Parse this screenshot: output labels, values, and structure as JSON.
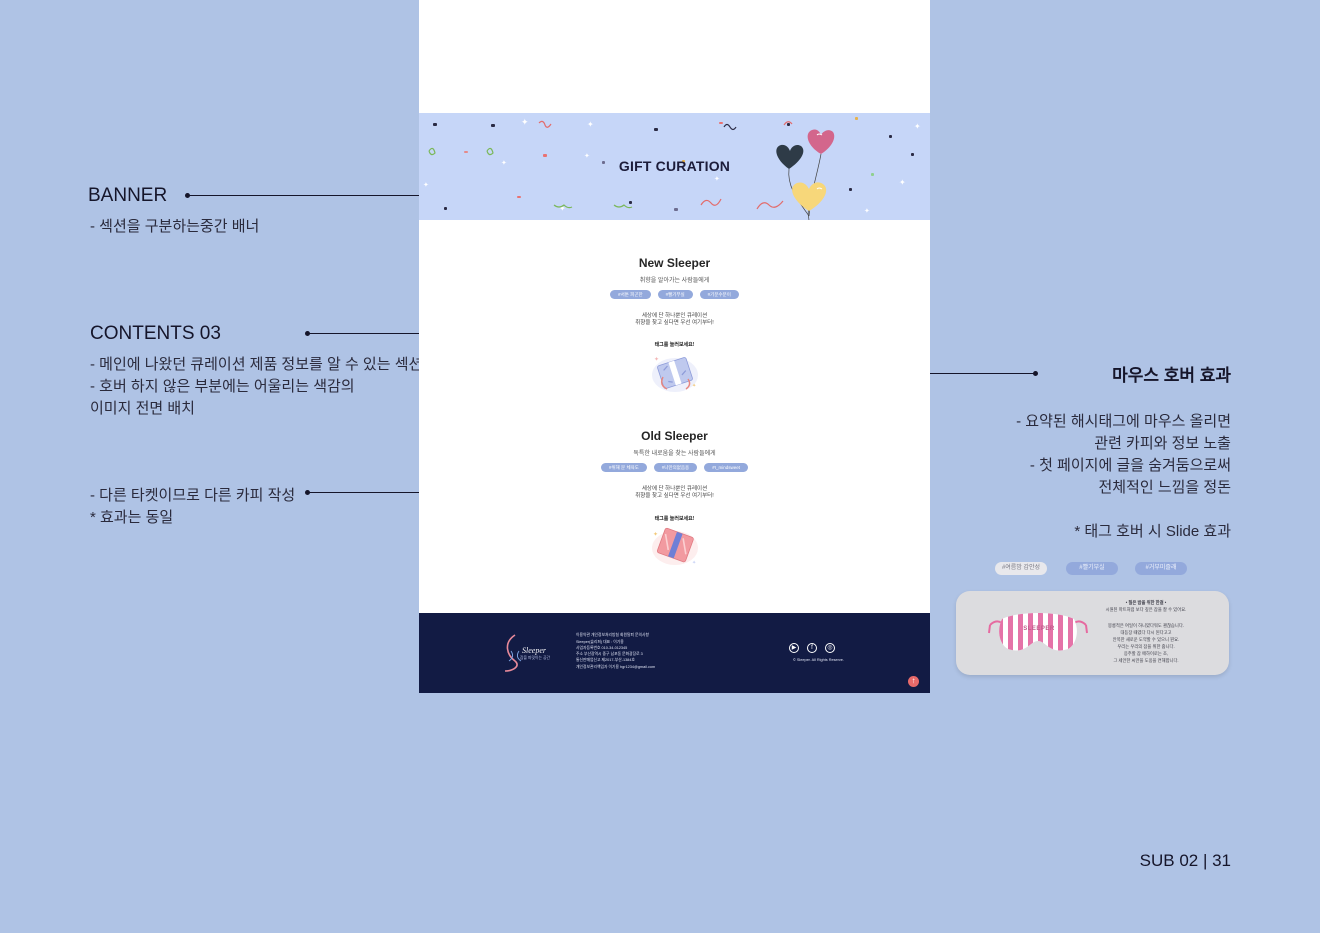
{
  "annotations": {
    "banner": {
      "title": "BANNER",
      "lines": [
        "- 섹션을 구분하는중간 배너"
      ]
    },
    "contents": {
      "title": "CONTENTS 03",
      "lines": [
        "- 메인에 나왔던 큐레이션 제품 정보를 알 수 있는 섹션",
        "- 호버 하지 않은 부분에는 어울리는 색감의",
        "이미지 전면 배치"
      ]
    },
    "ticket": {
      "lines": [
        "- 다른 타켓이므로 다른 카피 작성",
        "* 효과는 동일"
      ]
    },
    "hover": {
      "title": "마우스 호버 효과",
      "lines": [
        "- 요약된 해시태그에 마우스 올리면",
        "관련 카피와 정보 노출",
        "- 첫 페이지에 글을 숨겨둠으로써",
        "전체적인 느낌을 정돈"
      ],
      "note": "* 태그 호버 시 Slide 효과"
    }
  },
  "mockup": {
    "banner_title": "GIFT CURATION",
    "sections": [
      {
        "title": "New Sleeper",
        "subtitle": "취향을 알아가는 사람들에게",
        "tags": [
          "#서툰 피곤한",
          "#빨기부실",
          "#기분수분이"
        ],
        "copy": [
          "세상에 단 하나뿐인 큐레이션",
          "취향을 찾고 싶다면 우선 여기부터!"
        ],
        "gift_label": "태그를 눌러보세요!"
      },
      {
        "title": "Old Sleeper",
        "subtitle": "독특한 내로움을 찾는 사람들에게",
        "tags": [
          "#위해 문 체육도",
          "#나만의없음용",
          "#I_mindsweet"
        ],
        "copy": [
          "세상에 단 하나뿐인 큐레이션",
          "취향을 찾고 싶다면 우선 여기부터!"
        ],
        "gift_label": "태그를 눌러보세요!"
      }
    ],
    "footer": {
      "logo_text": "Sleeper",
      "logo_sub": "잠을 파밋이는 공간",
      "links": "이용약관   개인정보처리방침   회원탈퇴   문의사항",
      "info": [
        "Sleeper(슬리퍼)  대표 : 이기용",
        "사업자등록번호  010-34-012345",
        "주소  부산광역시 중구 남포동 문화광장로 3",
        "통신판매업신고  제2017-부산-1384호",
        "개인정보관리책임자  이기용  hgr1234@gmail.com"
      ],
      "copyright": "© Sleeper. All Rights Reserve.",
      "top_button": "↑"
    }
  },
  "hover_demo": {
    "pills": [
      "#여름밤 감안성",
      "#빨기부실",
      "#거부미즐래"
    ],
    "mask_text": "SLEEPER",
    "card_lines": [
      "• 질은 밤을 위한 한걸 •",
      "시원된 마트처럼 보다 깊은 잠을 잘 수 있어요.",
      "",
      "몽롱적은 여일이 하니였다워도 괜찮습니다.",
      "대등장 때였다 다시 된다고고",
      "안목한 새로운 도약할 수 있으니 뭔요.",
      "우리는 우리의 잠을 위한 줍니다.",
      "응주할 잠 애하이로는 조,",
      "그 세안한 씨만을 도옹을 연해합니다."
    ]
  },
  "page_number": "SUB 02 | 31"
}
